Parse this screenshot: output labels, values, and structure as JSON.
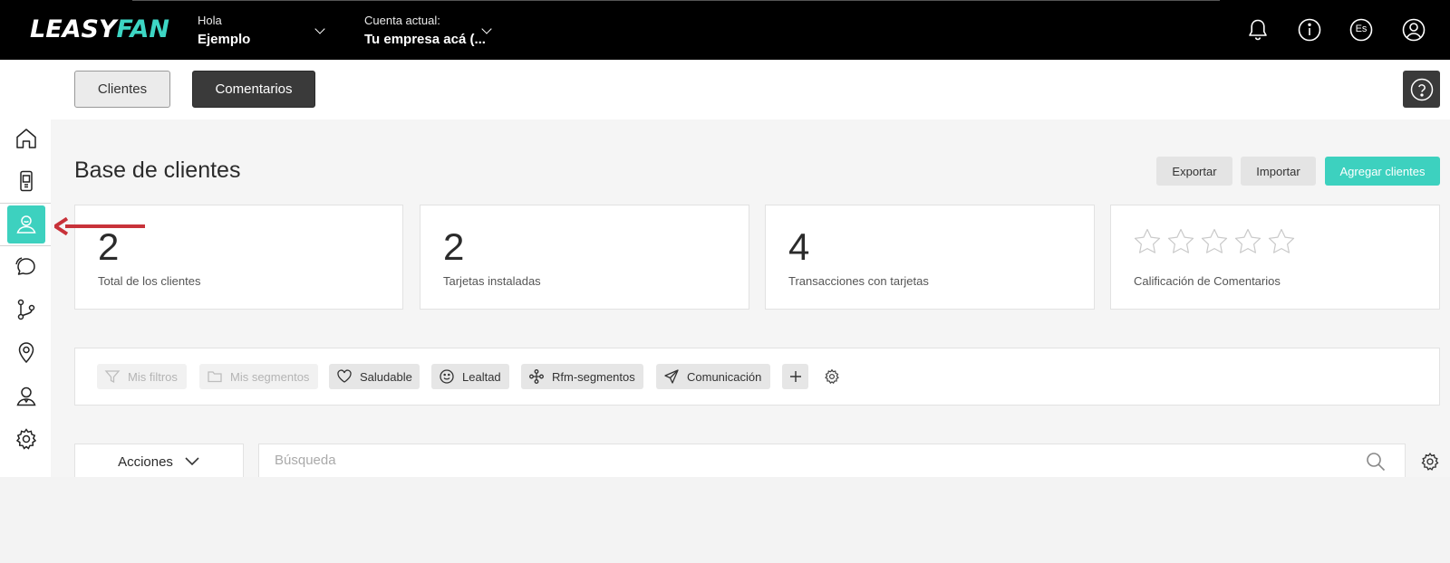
{
  "header": {
    "logo_part1": "LEASY",
    "logo_part2": "FAN",
    "greeting_label": "Hola",
    "greeting_name": "Ejemplo",
    "account_label": "Cuenta actual:",
    "account_name": "Tu empresa acá (...",
    "language": "Es",
    "icons": [
      "bell-icon",
      "info-icon",
      "language-icon",
      "user-profile-icon"
    ]
  },
  "sidebar": {
    "items": [
      {
        "icon": "home-icon"
      },
      {
        "icon": "mobile-card-icon"
      },
      {
        "icon": "clients-icon",
        "active": true
      },
      {
        "icon": "comments-icon"
      },
      {
        "icon": "flows-icon"
      },
      {
        "icon": "location-pin-icon"
      },
      {
        "icon": "staff-icon"
      },
      {
        "icon": "settings-icon"
      }
    ]
  },
  "tabs": {
    "clientes": "Clientes",
    "comentarios": "Comentarios"
  },
  "main": {
    "title": "Base de clientes",
    "buttons": {
      "export": "Exportar",
      "import": "Importar",
      "add": "Agregar clientes"
    },
    "stats": [
      {
        "value": "2",
        "label": "Total de los clientes"
      },
      {
        "value": "2",
        "label": "Tarjetas instaladas"
      },
      {
        "value": "4",
        "label": "Transacciones con tarjetas"
      },
      {
        "rating_stars": 5,
        "rating_filled": 0,
        "label": "Calificación de Comentarios"
      }
    ],
    "filters": {
      "mis_filtros": "Mis filtros",
      "mis_segmentos": "Mis segmentos",
      "saludable": "Saludable",
      "lealtad": "Lealtad",
      "rfm": "Rfm-segmentos",
      "comunicacion": "Comunicación"
    },
    "acciones": "Acciones",
    "search_placeholder": "Búsqueda"
  },
  "colors": {
    "accent": "#3dd1bf",
    "topbar": "#000000",
    "annotation_arrow": "#c8323a"
  }
}
